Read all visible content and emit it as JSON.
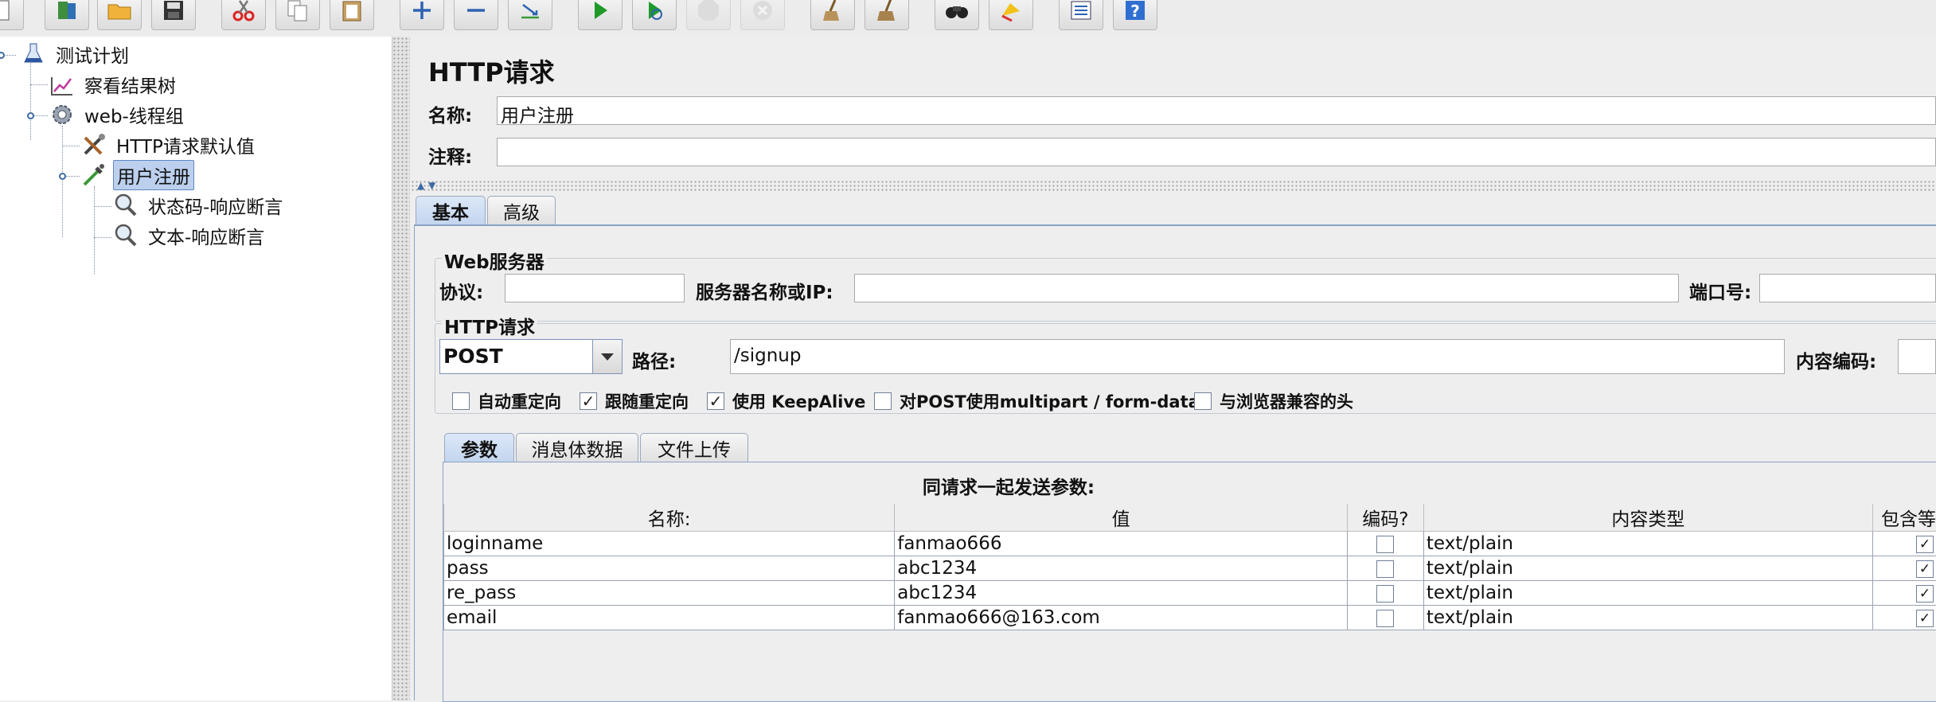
{
  "toolbar": {
    "buttons": [
      {
        "name": "new-icon",
        "disabled": false
      },
      {
        "name": "templates-icon",
        "disabled": false
      },
      {
        "name": "open-folder-icon",
        "disabled": false
      },
      {
        "name": "save-icon",
        "disabled": false
      },
      {
        "name": "cut-icon",
        "disabled": false
      },
      {
        "name": "copy-icon",
        "disabled": false
      },
      {
        "name": "paste-icon",
        "disabled": false
      },
      {
        "name": "expand-icon",
        "disabled": false
      },
      {
        "name": "collapse-icon",
        "disabled": false
      },
      {
        "name": "toggle-icon",
        "disabled": false
      },
      {
        "name": "start-icon",
        "disabled": false
      },
      {
        "name": "start-no-pause-icon",
        "disabled": false
      },
      {
        "name": "stop-icon",
        "disabled": true
      },
      {
        "name": "shutdown-icon",
        "disabled": true
      },
      {
        "name": "clear-icon",
        "disabled": false
      },
      {
        "name": "clear-all-icon",
        "disabled": false
      },
      {
        "name": "search-binoculars-icon",
        "disabled": false
      },
      {
        "name": "reset-search-icon",
        "disabled": false
      },
      {
        "name": "function-helper-icon",
        "disabled": false
      },
      {
        "name": "help-icon",
        "disabled": false
      }
    ]
  },
  "tree": {
    "nodes": [
      {
        "label": "测试计划",
        "icon": "test-plan-flask-icon",
        "level": 0
      },
      {
        "label": "察看结果树",
        "icon": "results-tree-chart-icon",
        "level": 1
      },
      {
        "label": "web-线程组",
        "icon": "thread-group-gear-icon",
        "level": 1
      },
      {
        "label": "HTTP请求默认值",
        "icon": "config-tools-icon",
        "level": 2
      },
      {
        "label": "用户注册",
        "icon": "sampler-pipette-icon",
        "level": 2,
        "selected": true
      },
      {
        "label": "状态码-响应断言",
        "icon": "assertion-magnifier-icon",
        "level": 3
      },
      {
        "label": "文本-响应断言",
        "icon": "assertion-magnifier-icon",
        "level": 3
      }
    ]
  },
  "main": {
    "title": "HTTP请求",
    "name_label": "名称:",
    "name_value": "用户注册",
    "comment_label": "注释:",
    "comment_value": "",
    "tabs": [
      {
        "label": "基本",
        "active": true
      },
      {
        "label": "高级",
        "active": false
      }
    ],
    "web_server": {
      "legend": "Web服务器",
      "protocol_label": "协议:",
      "protocol_value": "",
      "server_label": "服务器名称或IP:",
      "server_value": "",
      "port_label": "端口号:",
      "port_value": ""
    },
    "http_request": {
      "legend": "HTTP请求",
      "method": "POST",
      "path_label": "路径:",
      "path_value": "/signup",
      "encoding_label": "内容编码:",
      "encoding_value": ""
    },
    "options": [
      {
        "label": "自动重定向",
        "checked": false
      },
      {
        "label": "跟随重定向",
        "checked": true
      },
      {
        "label": "使用 KeepAlive",
        "checked": true
      },
      {
        "label": "对POST使用multipart / form-data",
        "checked": false
      },
      {
        "label": "与浏览器兼容的头",
        "checked": false
      }
    ],
    "sub_tabs": [
      {
        "label": "参数",
        "active": true
      },
      {
        "label": "消息体数据",
        "active": false
      },
      {
        "label": "文件上传",
        "active": false
      }
    ],
    "params": {
      "title": "同请求一起发送参数:",
      "headers": [
        "名称:",
        "值",
        "编码?",
        "内容类型",
        "包含等"
      ],
      "rows": [
        {
          "name": "loginname",
          "value": "fanmao666",
          "encode": false,
          "content_type": "text/plain",
          "include_equals": true
        },
        {
          "name": "pass",
          "value": "abc1234",
          "encode": false,
          "content_type": "text/plain",
          "include_equals": true
        },
        {
          "name": "re_pass",
          "value": "abc1234",
          "encode": false,
          "content_type": "text/plain",
          "include_equals": true
        },
        {
          "name": "email",
          "value": "fanmao666@163.com",
          "encode": false,
          "content_type": "text/plain",
          "include_equals": true
        }
      ]
    }
  }
}
